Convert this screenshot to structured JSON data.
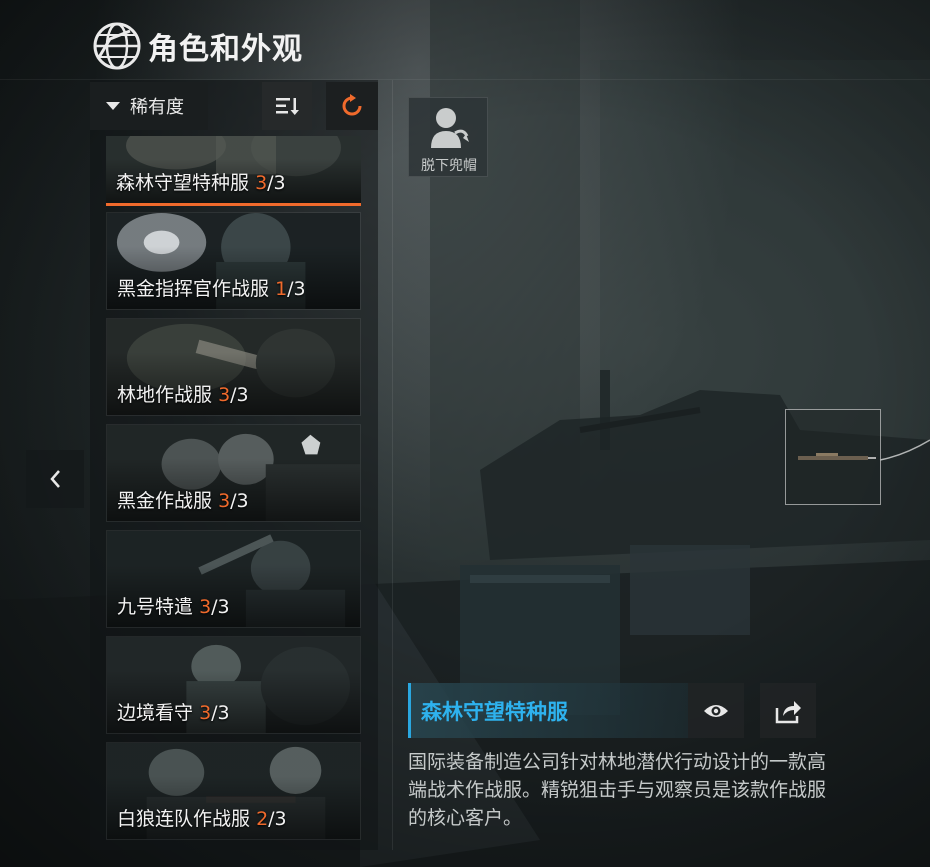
{
  "page": {
    "title": "角色和外观"
  },
  "sort": {
    "label": "稀有度"
  },
  "hood_toggle": {
    "label": "脱下兜帽"
  },
  "skins": [
    {
      "name": "森林守望特种服",
      "owned": "3",
      "total": "/3",
      "selected": true
    },
    {
      "name": "黑金指挥官作战服",
      "owned": "1",
      "total": "/3"
    },
    {
      "name": "林地作战服",
      "owned": "3",
      "total": "/3"
    },
    {
      "name": "黑金作战服",
      "owned": "3",
      "total": "/3"
    },
    {
      "name": "九号特遣",
      "owned": "3",
      "total": "/3"
    },
    {
      "name": "边境看守",
      "owned": "3",
      "total": "/3"
    },
    {
      "name": "白狼连队作战服",
      "owned": "2",
      "total": "/3"
    }
  ],
  "detail": {
    "title": "森林守望特种服",
    "description": "国际装备制造公司针对林地潜伏行动设计的一款高端战术作战服。精锐狙击手与观察员是该款作战服的核心客户。"
  },
  "colors": {
    "accent_orange": "#f06a2c",
    "accent_blue": "#2eb2ee"
  },
  "icons": {
    "header": "globe-icon",
    "sort_order": "sort-order-icon",
    "refresh": "refresh-icon",
    "hood": "hood-icon",
    "prev": "chevron-left-icon",
    "preview": "eye-icon",
    "share": "share-icon"
  }
}
